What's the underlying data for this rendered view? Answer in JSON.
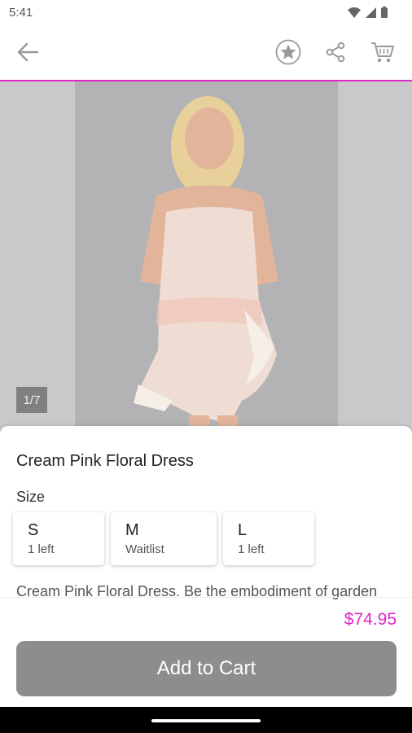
{
  "status_bar": {
    "time": "5:41",
    "icons": [
      "wifi-icon",
      "signal-icon",
      "battery-icon"
    ]
  },
  "app_bar": {
    "icons": [
      "arrow-left-icon",
      "star-icon",
      "share-icon",
      "cart-icon"
    ],
    "accent_color": "#e026c9"
  },
  "product": {
    "image_counter": "1/7",
    "title": "Cream Pink Floral Dress",
    "size_label": "Size",
    "sizes": [
      {
        "letter": "S",
        "availability": "1 left"
      },
      {
        "letter": "M",
        "availability": "Waitlist"
      },
      {
        "letter": "L",
        "availability": "1 left"
      }
    ],
    "description": "Cream Pink Floral Dress. Be the embodiment of garden",
    "price": "$74.95",
    "add_to_cart_label": "Add to Cart"
  },
  "colors": {
    "price": "#e026c9",
    "button_bg": "#8d8d8d"
  }
}
